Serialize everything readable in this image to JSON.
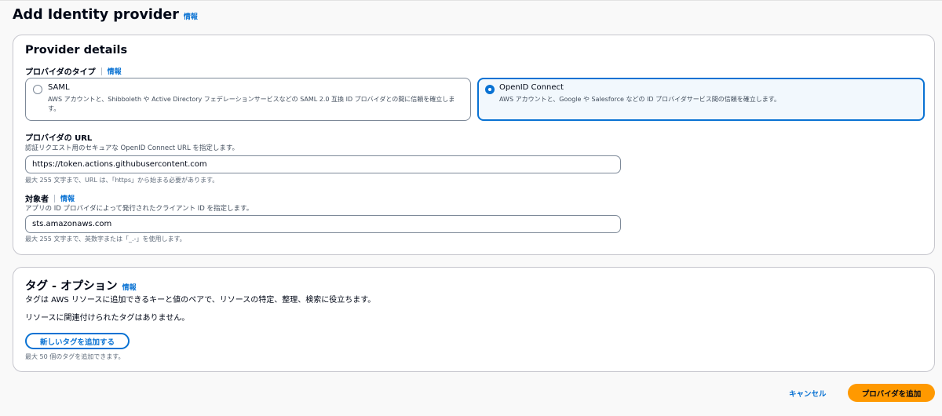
{
  "header": {
    "title": "Add Identity provider",
    "info": "情報"
  },
  "provider_details": {
    "title": "Provider details",
    "provider_type": {
      "label": "プロバイダのタイプ",
      "info": "情報",
      "options": [
        {
          "title": "SAML",
          "description": "AWS アカウントと、Shibboleth や Active Directory フェデレーションサービスなどの SAML 2.0 互換 ID プロバイダとの間に信頼を確立します。",
          "selected": false
        },
        {
          "title": "OpenID Connect",
          "description": "AWS アカウントと、Google や Salesforce などの ID プロバイダサービス間の信頼を確立します。",
          "selected": true
        }
      ]
    },
    "provider_url": {
      "label": "プロバイダの URL",
      "description": "認証リクエスト用のセキュアな OpenID Connect URL を指定します。",
      "value": "https://token.actions.githubusercontent.com",
      "hint": "最大 255 文字まで、URL は、「https」から始まる必要があります。"
    },
    "audience": {
      "label": "対象者",
      "info": "情報",
      "description": "アプリの ID プロバイダによって発行されたクライアント ID を指定します。",
      "value": "sts.amazonaws.com",
      "hint": "最大 255 文字まで、英数字または「_.-」を使用します。"
    }
  },
  "tags": {
    "title": "タグ - オプション",
    "info": "情報",
    "description": "タグは AWS リソースに追加できるキーと値のペアで、リソースの特定、整理、検索に役立ちます。",
    "empty_text": "リソースに関連付けられたタグはありません。",
    "add_button": "新しいタグを追加する",
    "hint": "最大 50 個のタグを追加できます。"
  },
  "footer": {
    "cancel": "キャンセル",
    "submit": "プロバイダを追加"
  },
  "colors": {
    "accent": "#0972d3",
    "primary_button": "#ff9900"
  }
}
